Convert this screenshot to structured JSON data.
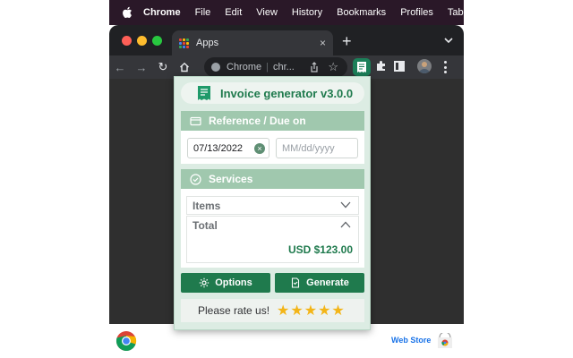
{
  "menubar": {
    "app_name": "Chrome",
    "items": [
      "File",
      "Edit",
      "View",
      "History",
      "Bookmarks",
      "Profiles",
      "Tab"
    ]
  },
  "browser": {
    "tab": {
      "title": "Apps",
      "close": "×"
    },
    "newtab": "+",
    "omnibox": {
      "origin": "Chrome",
      "separator": "|",
      "url": "chr..."
    },
    "footer": {
      "webstore_label": "Web Store"
    }
  },
  "popup": {
    "title": "Invoice generator v3.0.0",
    "reference_section": "Reference / Due on",
    "reference_date": "07/13/2022",
    "due_date_placeholder": "MM/dd/yyyy",
    "services_section": "Services",
    "items_label": "Items",
    "total_label": "Total",
    "total_amount": "USD $123.00",
    "options_button": "Options",
    "generate_button": "Generate",
    "rate_prompt": "Please rate us!",
    "rating_stars": "★★★★★",
    "rating_value": 5,
    "accent_color": "#1f7a4d"
  }
}
